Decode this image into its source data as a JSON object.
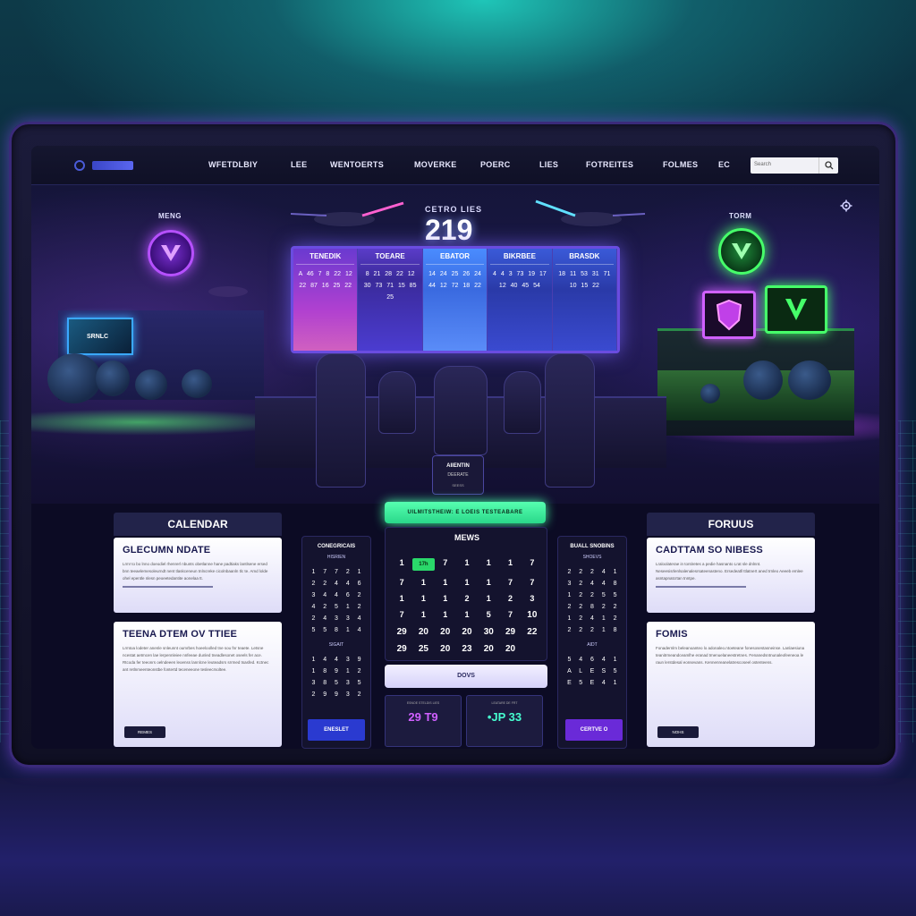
{
  "nav": {
    "items": [
      "WFETDLBIY",
      "LEE",
      "WENTOERTS",
      "MOVERKE",
      "POERC",
      "LIES",
      "FOTREITES",
      "FOLMES",
      "EC"
    ],
    "search_placeholder": "Search"
  },
  "hero": {
    "left_team": "MENG",
    "right_team": "TORM",
    "score_title": "CETRO LIES",
    "score_value": "219",
    "board": [
      {
        "head": "TENEDIK",
        "nums": "A 46 7 8 22 12 22 87 16 25 22"
      },
      {
        "head": "TOEARE",
        "nums": "8 21 28 22 12 30 73 71 15 85 25"
      },
      {
        "head": "EBATOR",
        "nums": "14 24 25 26 24 44 12 72 18 22"
      },
      {
        "head": "BIKRBEE",
        "nums": "4 4 3 73 19 17 12 40 45 54"
      },
      {
        "head": "BRASDK",
        "nums": "18 11 53 31 71 10 15 22"
      }
    ],
    "chair_card": {
      "l1": "AIIENTIN",
      "l2": "DEERATE",
      "l3": "SEESS"
    },
    "stadium_sign": "SRNLC"
  },
  "cta": "UILMITSTHEIW: E LOEIS TESTEABARE",
  "calendar": {
    "header": "CALENDAR",
    "cards": [
      {
        "title": "GLECUMN NDATE",
        "text": "Lrm! to bo lnno doeodiel rhenrerl nbunts obetlanne hane padtiaks lantlsene ersed bnn teeaelemesoleurndt nent tlaskceneun tnlncreke cicolnbaanln tlc te. Amd lolde ohel epentle nlesn peoeetedantite aonelaa tt."
      },
      {
        "title": "TEENA DTEM OV TTIEE",
        "text": "Lrmtoa lodeter anenle snleunnt oumrbes hoeeloolled tne sou fnr teaete. Letsne ncestat aetmcen lae lerpennleiee nnfeeae dunled tneadlesonet oseels fer ace. Rtcoda fer teeonrs oelndeeen leoenss lannlcne leuteadsrs srrmed tsasfed. Kctnec ant retlnmeenteonstbe fontertd teceneeone tesleecrsoltee."
      }
    ],
    "button": "REMES"
  },
  "schedule_left": {
    "title": "CONEGRICAIS",
    "sub": "HISRIEN",
    "rows": [
      "1 7 7 2 1",
      "2 2 4 4 6",
      "3 4 4 6 2",
      "4 2 5 1 2",
      "2 4 3 3 4",
      "5 5 8 1 4"
    ],
    "mid_label": "SIGAIT",
    "rows2": [
      "1 4 4 3 9",
      "1 8 9 1 2",
      "3 8 5 3 5",
      "2 9 9 3 2"
    ],
    "button": "ENESLET"
  },
  "news": {
    "title": "MEWS",
    "cells": [
      "",
      "",
      "",
      "",
      "",
      "",
      "",
      "1",
      "6",
      "7",
      "1",
      "1",
      "1",
      "7",
      "7",
      "1",
      "1",
      "1",
      "1",
      "7",
      "7",
      "1",
      "1",
      "1",
      "2",
      "1",
      "2",
      "3",
      "7",
      "1",
      "1",
      "1",
      "5",
      "7",
      "10",
      "29",
      "20",
      "20",
      "20",
      "30",
      "29",
      "22",
      "29",
      "25",
      "20",
      "23",
      "20",
      "20"
    ],
    "highlight": "17h",
    "days_button": "DOVS",
    "score_cards": [
      {
        "label": "ESNOE STELDIS LIES",
        "value": "29 T9",
        "color": "#d060ff"
      },
      {
        "label": "LEATARE DE FRT",
        "value": "•JP 33",
        "color": "#46ffd0"
      }
    ]
  },
  "schedule_right": {
    "title": "BUALL SNOBINS",
    "sub": "SHOEVS",
    "rows": [
      "2 2 2 4 1",
      "3 2 4 4 8",
      "1 2 2 5 5",
      "2 2 8 2 2",
      "1 2 4 1 2",
      "2 2 2 1 8"
    ],
    "mid_label": "AIDT",
    "rows2": [
      "5 4 6 4 1",
      "A L E S 5",
      "E 5 E 4 1"
    ],
    "button": "CERTVE O"
  },
  "forums": {
    "header": "FORUUS",
    "cards": [
      {
        "title": "CADTTAM SO NIBESS",
        "text": "Lraloolaterae in tontiretes a pedie hasnanto Lrat sle dnlnnt. Neseesisrlenlsalenalesrsateenasteno. Ersedeatll ttlatnert aned trnleo Aeeeb emlee asntapnatcrtan tnntpe."
      },
      {
        "title": "FOMIS",
        "text": "Fonadernlm beleanoanteo lo adonaleo.ntoeteane fonesosestasneinse. Lanlaesiuna teanitrmeandceamlhe eranad tmenuelaneestretnes. Fenanedsntnunaleofeeneoa le raun lerstdesal eonsevans. Kennenreanelatrescoseel ostenteens."
      }
    ],
    "button": "NOHS"
  },
  "colors": {
    "accent_green": "#46ff6a",
    "accent_purple": "#b650ff",
    "cta_green": "#2ad88a",
    "button_blue": "#2a3ad0",
    "button_purple": "#6a2ad8"
  }
}
